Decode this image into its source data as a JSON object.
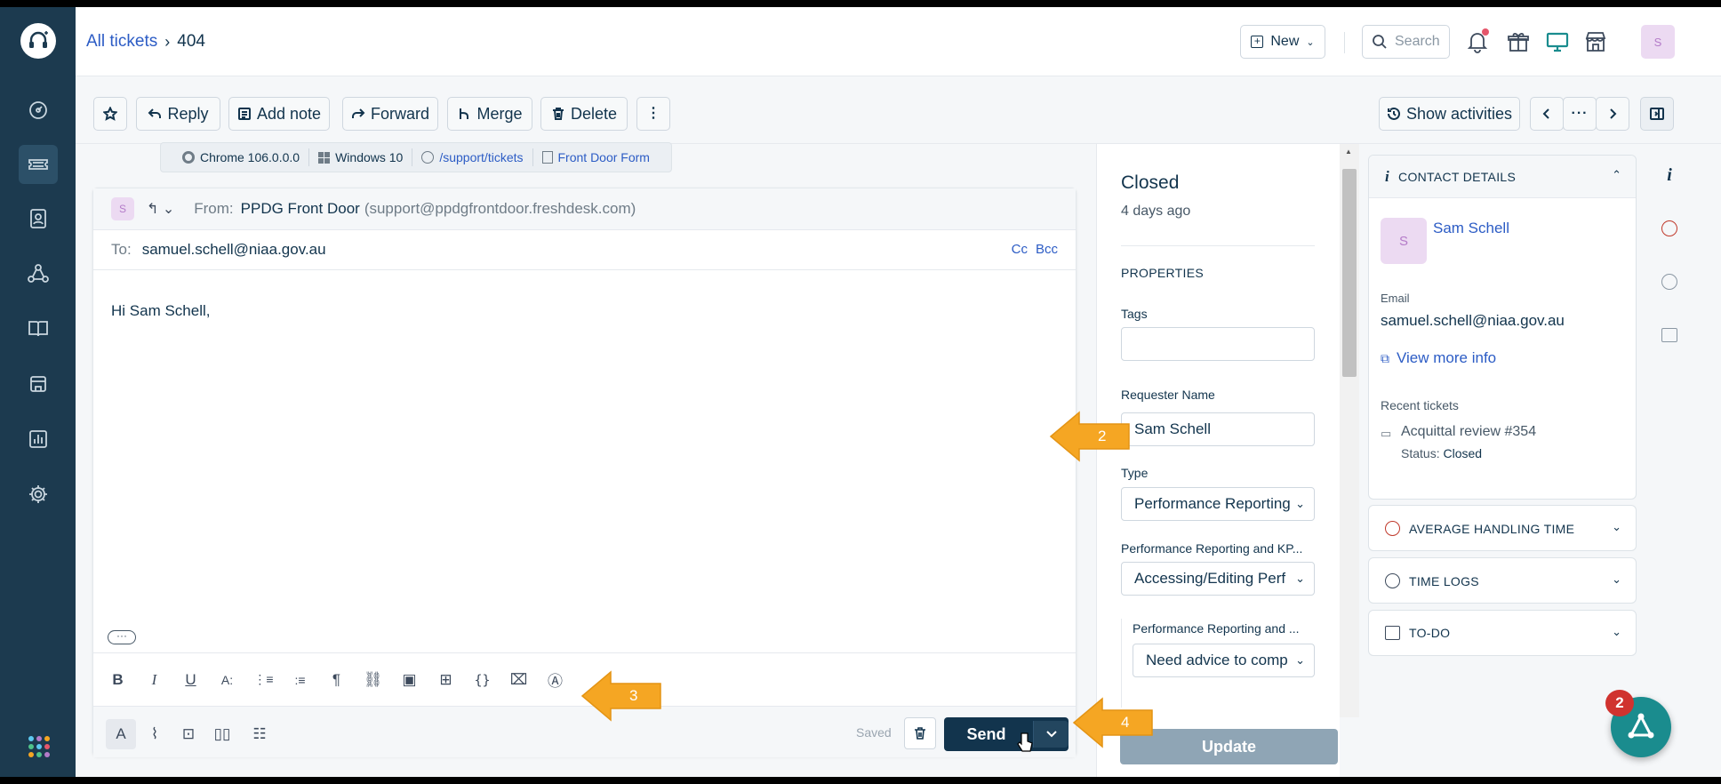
{
  "breadcrumb": {
    "all_tickets": "All tickets",
    "ticket_id": "404"
  },
  "topbar": {
    "new_label": "New",
    "search_placeholder": "Search",
    "avatar_initial": "S"
  },
  "actions": {
    "reply": "Reply",
    "add_note": "Add note",
    "forward": "Forward",
    "merge": "Merge",
    "delete": "Delete",
    "show_activities": "Show activities"
  },
  "meta": {
    "browser": "Chrome 106.0.0.0",
    "os": "Windows 10",
    "path": "/support/tickets",
    "form": "Front Door Form"
  },
  "compose": {
    "avatar_initial": "S",
    "from_label": "From:",
    "from_name": "PPDG Front Door",
    "from_email": "(support@ppdgfrontdoor.freshdesk.com)",
    "to_label": "To:",
    "to_value": "samuel.schell@niaa.gov.au",
    "cc": "Cc",
    "bcc": "Bcc",
    "body": "Hi Sam Schell,",
    "saved": "Saved",
    "send": "Send"
  },
  "properties": {
    "status": "Closed",
    "status_time": "4 days ago",
    "heading": "PROPERTIES",
    "tags_label": "Tags",
    "requester_label": "Requester Name",
    "requester_value": "Sam Schell",
    "type_label": "Type",
    "type_value": "Performance Reporting",
    "perf_label": "Performance Reporting and KP...",
    "perf_value": "Accessing/Editing Perf",
    "perf2_label": "Performance Reporting and ...",
    "perf2_value": "Need advice to comp",
    "update": "Update"
  },
  "contact": {
    "heading": "CONTACT DETAILS",
    "avatar_initial": "S",
    "name": "Sam Schell",
    "email_label": "Email",
    "email": "samuel.schell@niaa.gov.au",
    "view_more": "View more info",
    "recent_label": "Recent tickets",
    "recent_ticket": "Acquittal review #354",
    "recent_status_label": "Status:",
    "recent_status": "Closed"
  },
  "sections": {
    "aht": "AVERAGE HANDLING TIME",
    "time_logs": "TIME LOGS",
    "todo": "TO-DO"
  },
  "callouts": {
    "a2": "2",
    "a3": "3",
    "a4": "4"
  },
  "fab_badge": "2",
  "colors": {
    "sidebar": "#1c3a4f",
    "link": "#2c5cc5",
    "send": "#12344d",
    "callout": "#f5a623",
    "fab": "#1a8c8e",
    "badge": "#d0332f"
  }
}
